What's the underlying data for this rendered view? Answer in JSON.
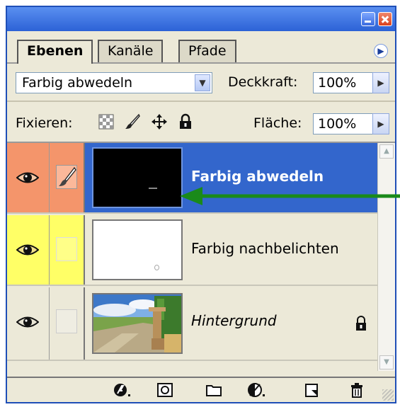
{
  "tabs": [
    {
      "label": "Ebenen",
      "active": true
    },
    {
      "label": "Kanäle",
      "active": false
    },
    {
      "label": "Pfade",
      "active": false
    }
  ],
  "blend_mode": {
    "value": "Farbig abwedeln"
  },
  "opacity": {
    "label": "Deckkraft:",
    "value": "100%"
  },
  "lock": {
    "label": "Fixieren:",
    "icons": [
      "transparency-lock-icon",
      "brush-lock-icon",
      "move-lock-icon",
      "padlock-icon"
    ]
  },
  "fill": {
    "label": "Fläche:",
    "value": "100%"
  },
  "layers": [
    {
      "name": "Farbig abwedeln",
      "selected": true,
      "visible": true,
      "link_icon": "brush-icon",
      "thumbnail": "black"
    },
    {
      "name": "Farbig nachbelichten",
      "selected": false,
      "visible": true,
      "link_icon": "none",
      "thumbnail": "white"
    },
    {
      "name": "Hintergrund",
      "selected": false,
      "visible": true,
      "link_icon": "none",
      "thumbnail": "landscape-photo",
      "locked": true
    }
  ],
  "colors": {
    "selected_row": "#3366cc",
    "eye_col_selected": "#f4956b",
    "eye_col_yellow": "#ffff66",
    "annotation_arrow": "#1a8a1a",
    "title_bar": "#2c62d6"
  },
  "bottom_icons": [
    "layer-style-icon",
    "layer-mask-icon",
    "new-group-icon",
    "adjustment-layer-icon",
    "new-layer-icon",
    "trash-icon"
  ]
}
